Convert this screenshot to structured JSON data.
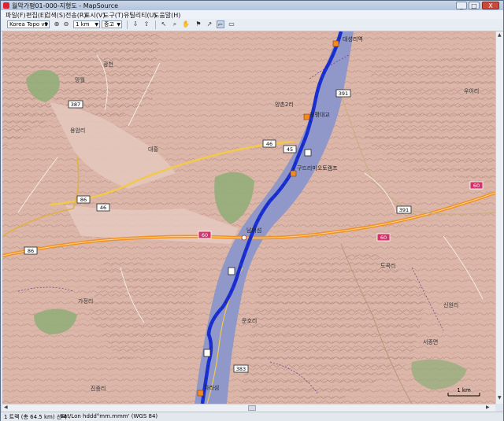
{
  "window": {
    "title": "월악가평01-000-지형도 - MapSource",
    "min_label": "_",
    "max_label": "□",
    "close_label": "X"
  },
  "menu": [
    "파일(F)",
    "편집(E)",
    "검색(S)",
    "전송(R)",
    "표시(V)",
    "도구(T)",
    "유틸리티(U)",
    "도움말(H)"
  ],
  "toolbar": {
    "product": "Korea Topo v9",
    "zoom": "1 km",
    "detail": "중고"
  },
  "map": {
    "highway_shields": [
      "60",
      "60",
      "60",
      "86",
      "86",
      "45",
      "46",
      "46",
      "387",
      "391",
      "383",
      "391"
    ],
    "places": [
      "용암리",
      "광천",
      "대흥",
      "망월",
      "양촌2리",
      "도곡리",
      "우이리",
      "서종면",
      "문호리",
      "가정리",
      "진중리",
      "신원리"
    ],
    "pois": [
      "대성리역",
      "청평대교",
      "구드리미오토캠프",
      "남이섬",
      "자라섬"
    ],
    "scale_label": "1 km"
  },
  "status": {
    "count": "1 트랙 (총 64.5 km) 선택",
    "coords": "Lat/Lon hddd°mm.mmm' (WGS 84)"
  },
  "colors": {
    "river": "#8f98c8",
    "route": "#1a2fd6",
    "terrain": "#dcb6a9",
    "highway": "#ef9222",
    "forest": "#8fae77"
  }
}
